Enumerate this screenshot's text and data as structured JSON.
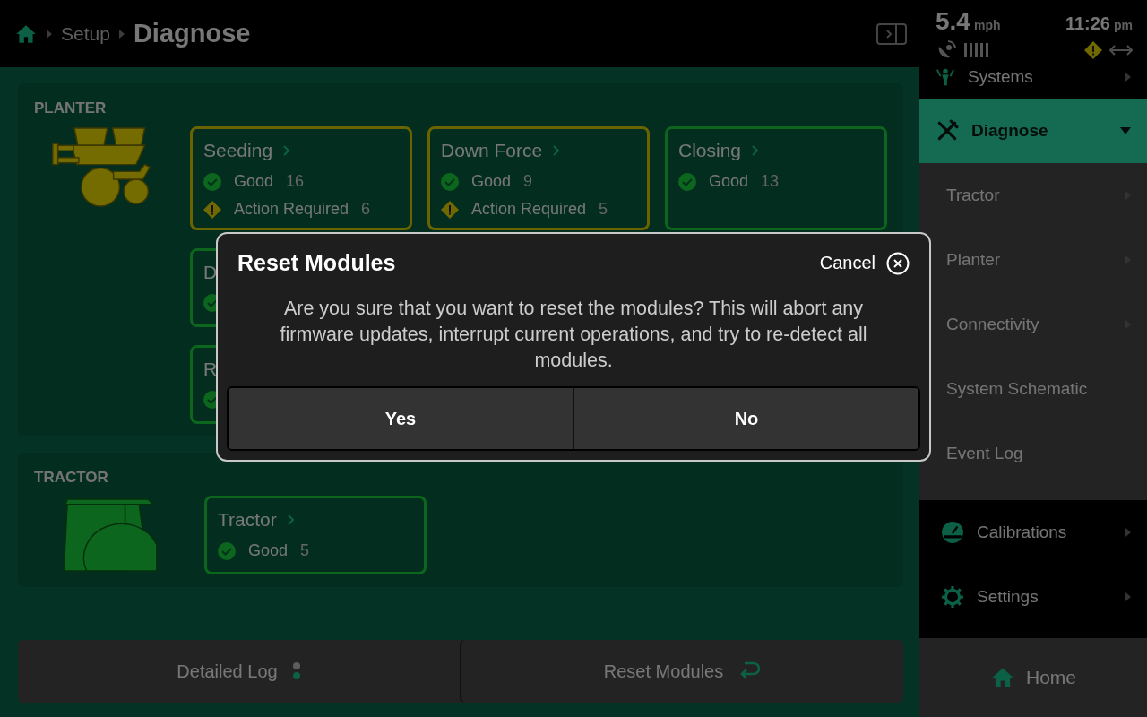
{
  "breadcrumb": {
    "items": [
      "Setup"
    ],
    "current": "Diagnose"
  },
  "sections": [
    {
      "title": "PLANTER",
      "card_rows": [
        [
          {
            "title": "Seeding",
            "alert": true,
            "statuses": [
              {
                "kind": "good",
                "label": "Good",
                "count": "16"
              },
              {
                "kind": "action",
                "label": "Action Required",
                "count": "6"
              }
            ]
          },
          {
            "title": "Down Force",
            "alert": true,
            "statuses": [
              {
                "kind": "good",
                "label": "Good",
                "count": "9"
              },
              {
                "kind": "action",
                "label": "Action Required",
                "count": "5"
              }
            ]
          },
          {
            "title": "Closing",
            "alert": false,
            "statuses": [
              {
                "kind": "good",
                "label": "Good",
                "count": "13"
              }
            ]
          }
        ],
        [
          {
            "title": "D",
            "alert": false,
            "statuses": [
              {
                "kind": "good"
              }
            ]
          }
        ],
        [
          {
            "title": "R",
            "alert": false,
            "statuses": [
              {
                "kind": "good"
              }
            ]
          }
        ]
      ]
    },
    {
      "title": "TRACTOR",
      "card_rows": [
        [
          {
            "title": "Tractor",
            "alert": false,
            "statuses": [
              {
                "kind": "good",
                "label": "Good",
                "count": "5"
              }
            ]
          }
        ]
      ]
    }
  ],
  "actions": [
    {
      "label": "Detailed Log"
    },
    {
      "label": "Reset Modules"
    }
  ],
  "status": {
    "speed": "5.4",
    "speed_unit": "mph",
    "time": "11:26",
    "time_unit": "pm"
  },
  "nav": [
    {
      "label": "Systems",
      "kind": "header",
      "has_arrow": true,
      "selected": false
    },
    {
      "label": "Diagnose",
      "kind": "section",
      "expanded": true,
      "selected": true
    },
    {
      "label": "Tractor",
      "kind": "sub",
      "has_arrow": true,
      "selected": false
    },
    {
      "label": "Planter",
      "kind": "sub",
      "has_arrow": true,
      "selected": false
    },
    {
      "label": "Connectivity",
      "kind": "sub",
      "has_arrow": true,
      "selected": false
    },
    {
      "label": "System Schematic",
      "kind": "sub",
      "has_arrow": false,
      "selected": false
    },
    {
      "label": "Event Log",
      "kind": "sub",
      "has_arrow": false,
      "selected": false
    },
    {
      "label": "Calibrations",
      "kind": "main",
      "has_arrow": true,
      "selected": false
    },
    {
      "label": "Settings",
      "kind": "main",
      "has_arrow": true,
      "selected": false
    }
  ],
  "home": {
    "label": "Home"
  },
  "dialog": {
    "title": "Reset Modules",
    "cancel": "Cancel",
    "message": "Are you sure that you want to reset the modules?  This will abort any firmware updates, interrupt current operations, and try to re-detect all modules.",
    "buttons": [
      "Yes",
      "No"
    ]
  }
}
